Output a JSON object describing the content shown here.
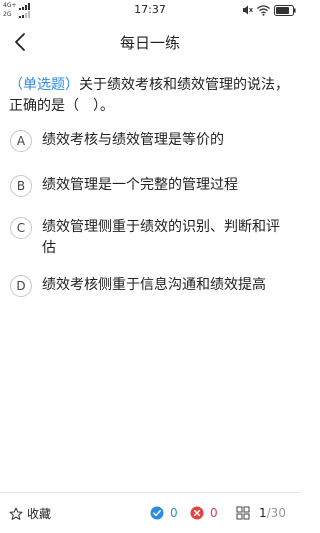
{
  "status_bar": {
    "network_top": "4G+",
    "network_bottom": "2G",
    "time": "17:37"
  },
  "header": {
    "title": "每日一练",
    "back_icon": "chevron-left-icon"
  },
  "question": {
    "type_label": "（单选题）",
    "text": "关于绩效考核和绩效管理的说法，正确的是（　）。"
  },
  "options": [
    {
      "letter": "A",
      "text": "绩效考核与绩效管理是等价的"
    },
    {
      "letter": "B",
      "text": "绩效管理是一个完整的管理过程"
    },
    {
      "letter": "C",
      "text": "绩效管理侧重于绩效的识别、判断和评估"
    },
    {
      "letter": "D",
      "text": "绩效考核侧重于信息沟通和绩效提高"
    }
  ],
  "bottom_bar": {
    "favorite_label": "收藏",
    "correct_count": "0",
    "wrong_count": "0",
    "progress_current": "1",
    "progress_total": "/30"
  },
  "colors": {
    "accent_blue": "#2d8ce0",
    "error_red": "#e34343"
  }
}
